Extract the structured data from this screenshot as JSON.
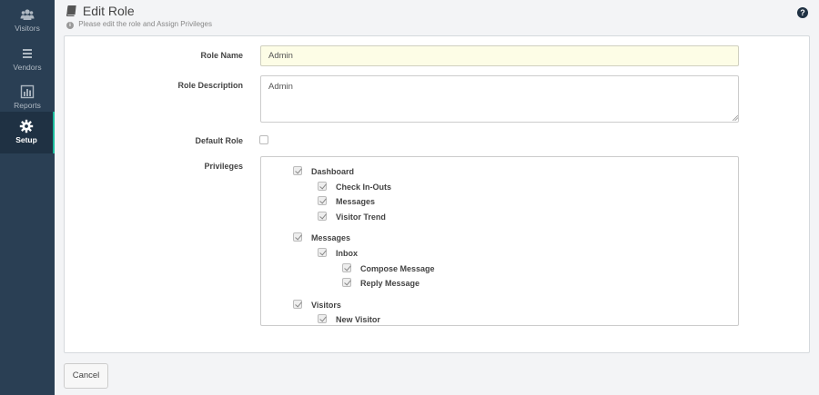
{
  "sidebar": {
    "items": [
      {
        "label": "Visitors",
        "icon": "users-icon"
      },
      {
        "label": "Vendors",
        "icon": "list-icon"
      },
      {
        "label": "Reports",
        "icon": "bar-chart-icon"
      },
      {
        "label": "Setup",
        "icon": "gear-icon",
        "active": true
      }
    ]
  },
  "header": {
    "title": "Edit Role",
    "subtitle": "Please edit the role and Assign Privileges"
  },
  "form": {
    "role_name_label": "Role Name",
    "role_name_value": "Admin",
    "role_description_label": "Role Description",
    "role_description_value": "Admin",
    "default_role_label": "Default Role",
    "default_role_checked": false,
    "privileges_label": "Privileges",
    "privileges": [
      {
        "label": "Dashboard",
        "level": 0,
        "checked": true
      },
      {
        "label": "Check In-Outs",
        "level": 1,
        "checked": true
      },
      {
        "label": "Messages",
        "level": 1,
        "checked": true
      },
      {
        "label": "Visitor Trend",
        "level": 1,
        "checked": true
      },
      {
        "label": "Messages",
        "level": 0,
        "checked": true
      },
      {
        "label": "Inbox",
        "level": 1,
        "checked": true
      },
      {
        "label": "Compose Message",
        "level": 2,
        "checked": true
      },
      {
        "label": "Reply Message",
        "level": 2,
        "checked": true
      },
      {
        "label": "Visitors",
        "level": 0,
        "checked": true
      },
      {
        "label": "New Visitor",
        "level": 1,
        "checked": true
      }
    ]
  },
  "actions": {
    "cancel_label": "Cancel"
  },
  "colors": {
    "sidebar_bg": "#2a3f54",
    "active_accent": "#1abb9c",
    "input_highlight": "#fdfde6"
  }
}
